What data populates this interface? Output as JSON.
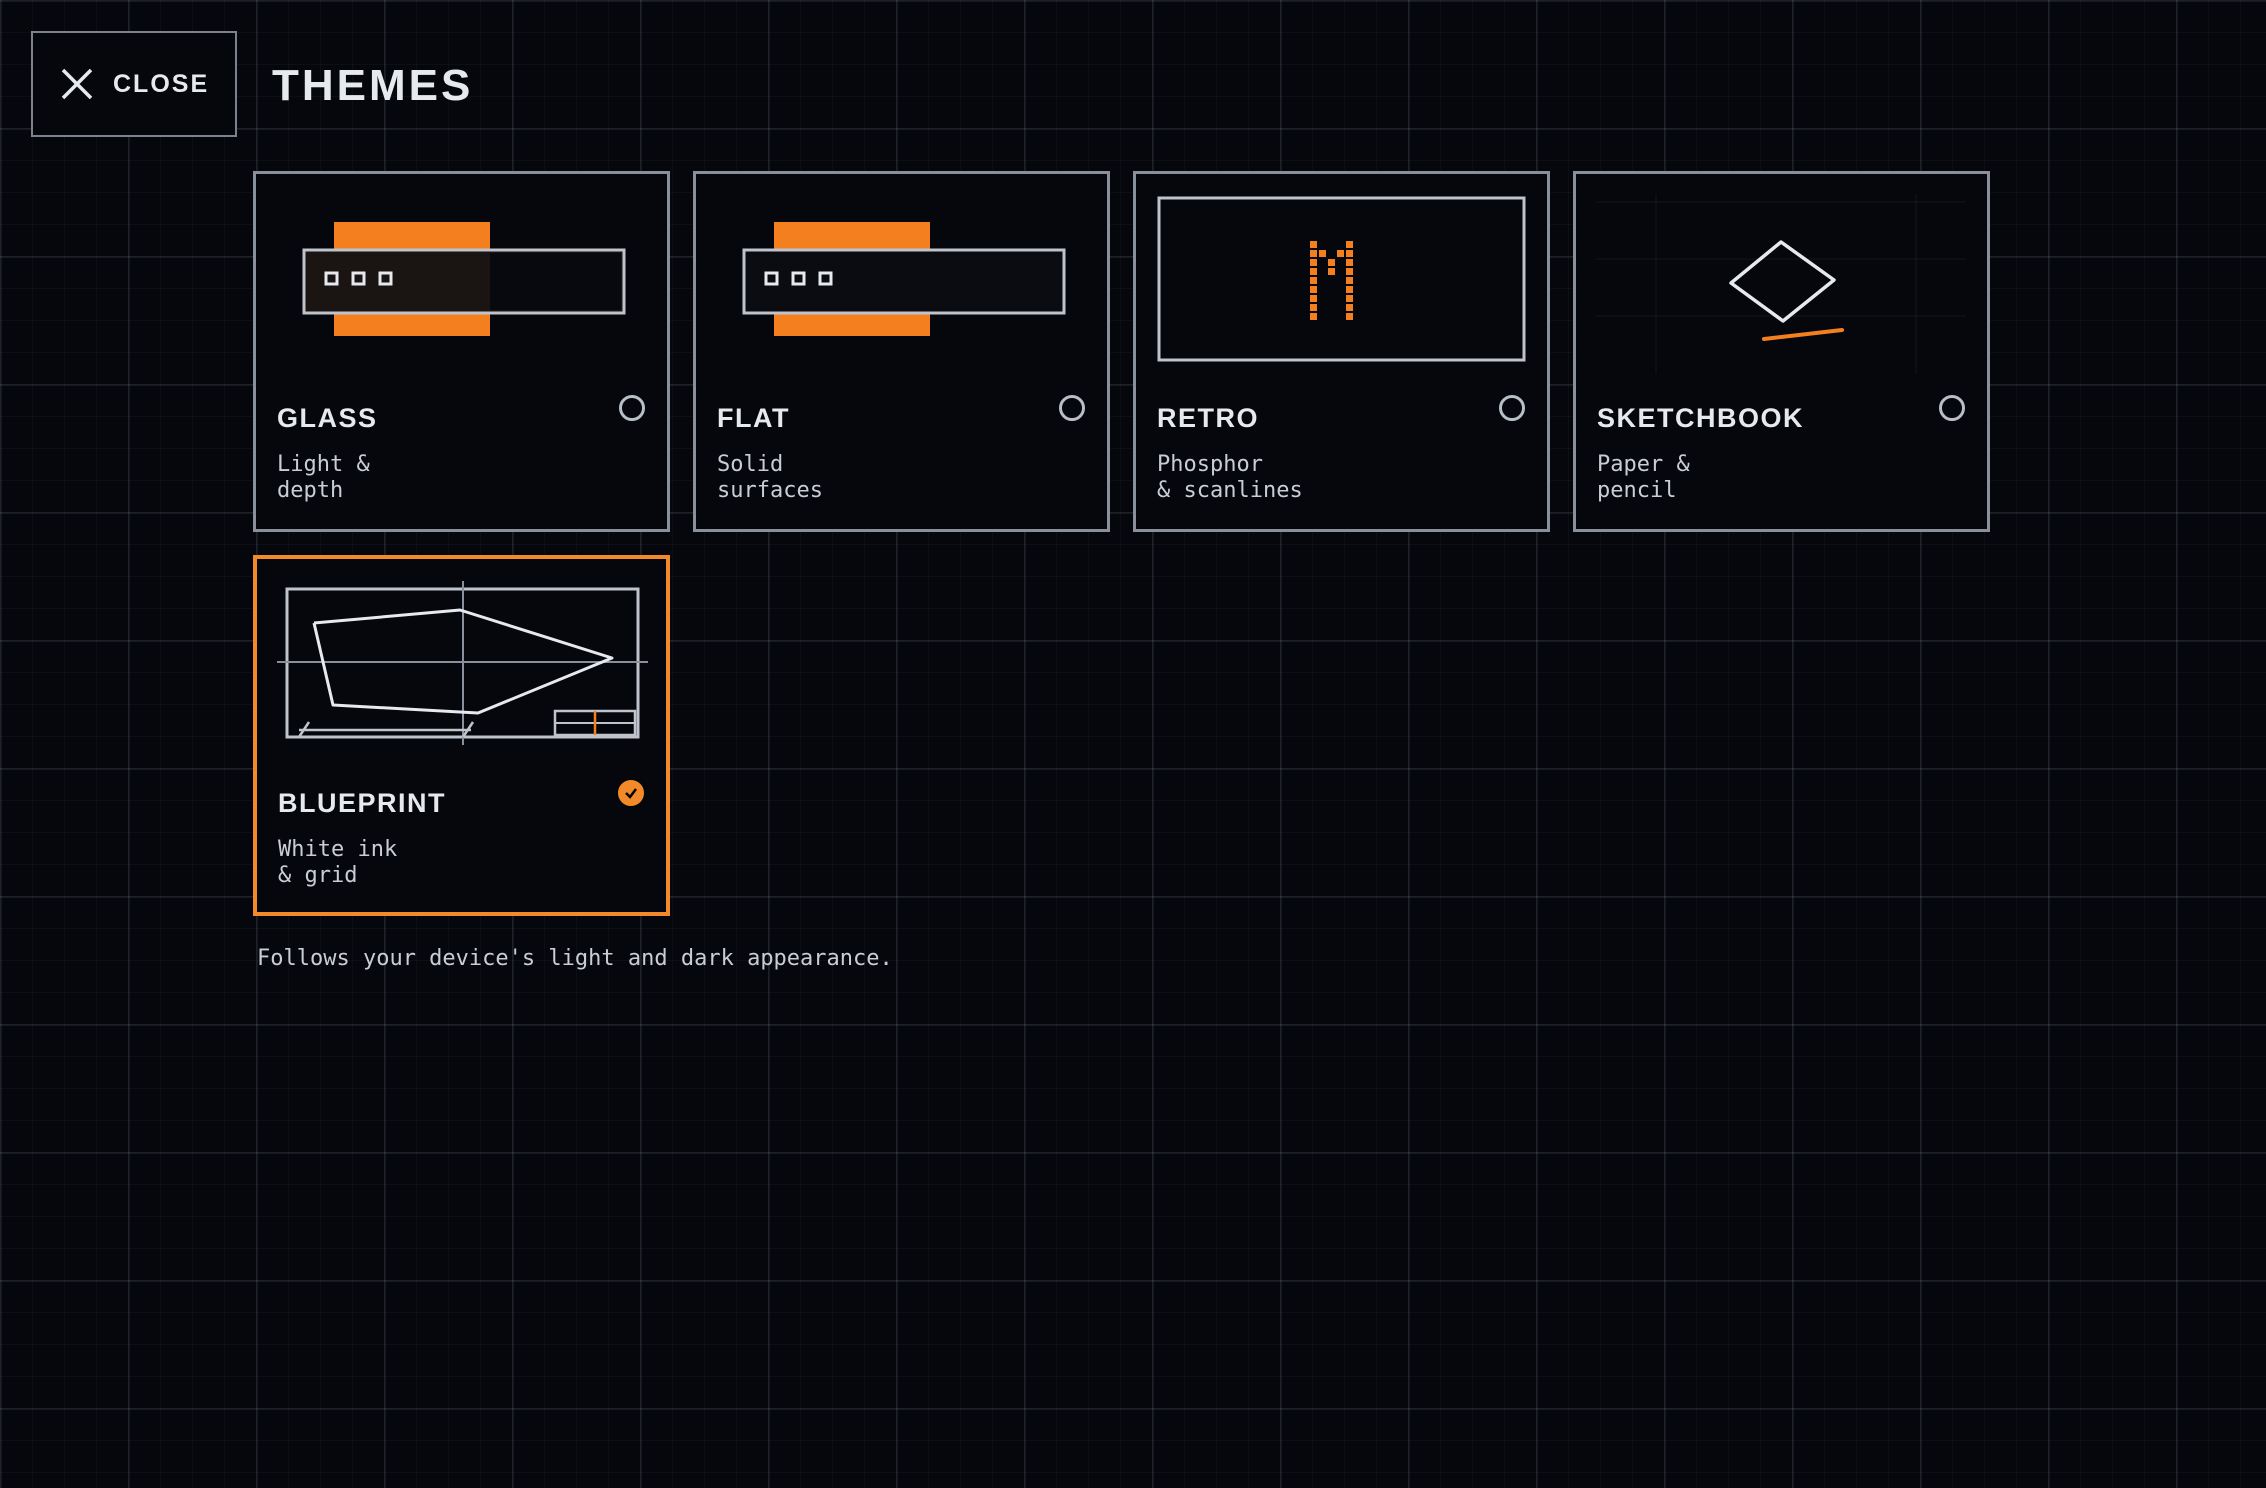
{
  "header": {
    "close_label": "CLOSE",
    "title": "THEMES"
  },
  "themes": [
    {
      "name": "GLASS",
      "description": "Light &\ndepth",
      "selected": false,
      "icon": "glass-preview-icon"
    },
    {
      "name": "FLAT",
      "description": "Solid\nsurfaces",
      "selected": false,
      "icon": "flat-preview-icon"
    },
    {
      "name": "RETRO",
      "description": "Phosphor\n& scanlines",
      "selected": false,
      "icon": "retro-preview-icon"
    },
    {
      "name": "SKETCHBOOK",
      "description": "Paper &\npencil",
      "selected": false,
      "icon": "sketchbook-preview-icon"
    },
    {
      "name": "BLUEPRINT",
      "description": "White ink\n& grid",
      "selected": true,
      "icon": "blueprint-preview-icon"
    }
  ],
  "footnote": "Follows your device's light and dark appearance.",
  "colors": {
    "accent": "#f28a2a",
    "background": "#05070c",
    "border": "#8a909b",
    "text": "#e6e9ee"
  }
}
